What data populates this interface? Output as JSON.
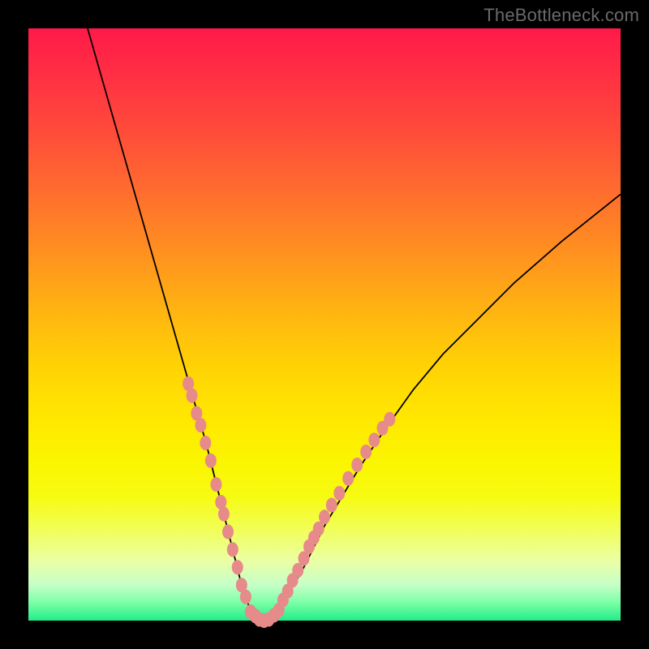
{
  "watermark": "TheBottleneck.com",
  "chart_data": {
    "type": "line",
    "title": "",
    "xlabel": "",
    "ylabel": "",
    "xlim": [
      0,
      100
    ],
    "ylim": [
      0,
      100
    ],
    "grid": false,
    "series": [
      {
        "name": "bottleneck-curve",
        "x": [
          10,
          12,
          14,
          16,
          18,
          20,
          22,
          24,
          26,
          28,
          30,
          32,
          33,
          34,
          35,
          36,
          37,
          38,
          39,
          40,
          41,
          42,
          44,
          46,
          48,
          50,
          53,
          56,
          60,
          65,
          70,
          76,
          82,
          90,
          100
        ],
        "y": [
          100,
          93,
          86,
          79,
          72,
          65,
          58,
          51,
          44,
          37,
          30,
          22,
          18,
          14,
          10,
          6,
          3,
          1,
          0,
          0,
          1,
          2,
          5,
          8,
          12,
          16,
          21,
          26,
          32,
          39,
          45,
          51,
          57,
          64,
          72
        ],
        "color": "#000000",
        "stroke_width": 1.8
      }
    ],
    "marker_clusters": [
      {
        "name": "left-cluster",
        "color": "#e78a8a",
        "points": [
          {
            "x": 27.0,
            "y": 40
          },
          {
            "x": 27.6,
            "y": 38
          },
          {
            "x": 28.4,
            "y": 35
          },
          {
            "x": 29.1,
            "y": 33
          },
          {
            "x": 29.9,
            "y": 30
          },
          {
            "x": 30.8,
            "y": 27
          },
          {
            "x": 31.7,
            "y": 23
          },
          {
            "x": 32.5,
            "y": 20
          },
          {
            "x": 33.0,
            "y": 18
          },
          {
            "x": 33.7,
            "y": 15
          },
          {
            "x": 34.5,
            "y": 12
          },
          {
            "x": 35.3,
            "y": 9
          },
          {
            "x": 36.0,
            "y": 6
          },
          {
            "x": 36.7,
            "y": 4
          }
        ]
      },
      {
        "name": "bottom-cluster",
        "color": "#e78a8a",
        "points": [
          {
            "x": 37.5,
            "y": 1.5
          },
          {
            "x": 38.3,
            "y": 0.8
          },
          {
            "x": 39.0,
            "y": 0.2
          },
          {
            "x": 39.8,
            "y": 0.0
          },
          {
            "x": 40.6,
            "y": 0.2
          },
          {
            "x": 41.5,
            "y": 0.9
          },
          {
            "x": 42.3,
            "y": 1.8
          }
        ]
      },
      {
        "name": "right-cluster",
        "color": "#e78a8a",
        "points": [
          {
            "x": 43.0,
            "y": 3.5
          },
          {
            "x": 43.8,
            "y": 5.0
          },
          {
            "x": 44.6,
            "y": 6.8
          },
          {
            "x": 45.5,
            "y": 8.5
          },
          {
            "x": 46.5,
            "y": 10.5
          },
          {
            "x": 47.4,
            "y": 12.5
          },
          {
            "x": 48.2,
            "y": 14.0
          },
          {
            "x": 49.0,
            "y": 15.5
          },
          {
            "x": 50.0,
            "y": 17.5
          },
          {
            "x": 51.2,
            "y": 19.5
          },
          {
            "x": 52.5,
            "y": 21.5
          },
          {
            "x": 54.0,
            "y": 24.0
          },
          {
            "x": 55.5,
            "y": 26.3
          },
          {
            "x": 57.0,
            "y": 28.5
          },
          {
            "x": 58.4,
            "y": 30.5
          },
          {
            "x": 59.8,
            "y": 32.5
          },
          {
            "x": 61.0,
            "y": 34.0
          }
        ]
      }
    ]
  }
}
